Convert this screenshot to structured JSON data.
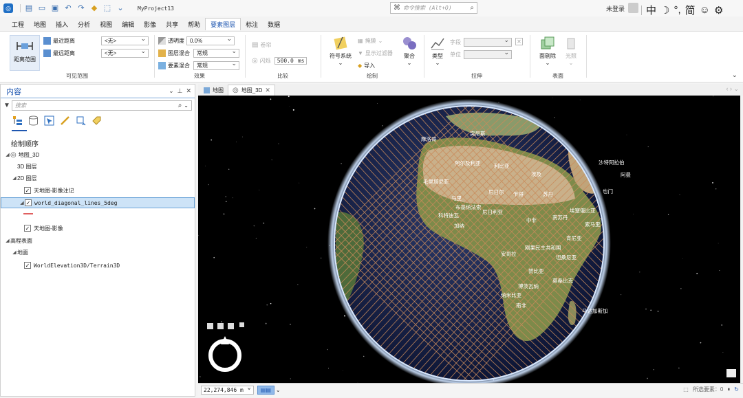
{
  "titlebar": {
    "project_name": "MyProject13",
    "search_placeholder": "命令搜索 (Alt+Q)",
    "login": "未登录",
    "tools": [
      "中",
      "☽",
      "°,",
      "简",
      "☺",
      "⚙"
    ]
  },
  "tabs": [
    "工程",
    "地图",
    "插入",
    "分析",
    "视图",
    "编辑",
    "影像",
    "共享",
    "帮助",
    "要素图层",
    "标注",
    "数据"
  ],
  "active_tab": "要素图层",
  "ribbon": {
    "visible_range": {
      "big_button": "距离范围",
      "min_label": "最近距离",
      "max_label": "最远距离",
      "min_value": "<无>",
      "max_value": "<无>",
      "group_label": "可见范围"
    },
    "effects": {
      "transparency_label": "透明度",
      "transparency_value": "0.0%",
      "layer_blend_label": "图层混合",
      "layer_blend_value": "常规",
      "feature_blend_label": "要素混合",
      "feature_blend_value": "常规",
      "group_label": "效果"
    },
    "compare": {
      "swipe_label": "卷帘",
      "flicker_label": "闪烁",
      "flicker_value": "500.0",
      "flicker_unit": "ms",
      "group_label": "比较"
    },
    "drawing": {
      "symbology_label": "符号系统",
      "mask_label": "掩膜",
      "show_filter_label": "显示过滤器",
      "import_label": "导入",
      "aggregate_label": "聚合",
      "group_label": "绘制"
    },
    "extrusion": {
      "type_label": "类型",
      "field_label": "字段",
      "unit_label": "单位",
      "group_label": "拉伸"
    },
    "faces": {
      "culling_label": "面剔除",
      "lighting_label": "光照",
      "group_label": "表面"
    }
  },
  "contents": {
    "title": "内容",
    "search_placeholder": "搜索",
    "section_title": "绘制顺序",
    "tree": [
      {
        "label": "地图_3D",
        "level": 0,
        "arrow": "◢",
        "check": false,
        "icon": true
      },
      {
        "label": "3D 图层",
        "level": 1,
        "arrow": "",
        "check": false
      },
      {
        "label": "2D 图层",
        "level": 1,
        "arrow": "◢",
        "check": false
      },
      {
        "label": "天地图-影像注记",
        "level": 2,
        "arrow": "",
        "check": true
      },
      {
        "label": "world_diagonal_lines_5deg",
        "level": 2,
        "arrow": "◢",
        "check": true,
        "selected": true,
        "mono": true
      },
      {
        "label": "天地图-影像",
        "level": 2,
        "arrow": "",
        "check": true
      },
      {
        "label": "高程表面",
        "level": 0,
        "arrow": "◢",
        "check": false
      },
      {
        "label": "地面",
        "level": 1,
        "arrow": "◢",
        "check": false
      },
      {
        "label": "WorldElevation3D/Terrain3D",
        "level": 2,
        "arrow": "",
        "check": true,
        "mono": true
      }
    ]
  },
  "map_tabs": [
    {
      "label": "地图",
      "active": false
    },
    {
      "label": "地图_3D",
      "active": true
    }
  ],
  "map_labels": [
    "阿尔及利亚",
    "利比亚",
    "埃及",
    "毛里塔尼亚",
    "马里",
    "尼日尔",
    "乍得",
    "苏丹",
    "埃塞俄比亚",
    "尼日利亚",
    "中非",
    "南苏丹",
    "刚果民主共和国",
    "安哥拉",
    "赞比亚",
    "博茨瓦纳",
    "纳米比亚",
    "南非",
    "肯尼亚",
    "索马里",
    "坦桑尼亚",
    "莫桑比克",
    "马达加斯加",
    "科特迪瓦",
    "加纳",
    "布基纳法索",
    "摩洛哥",
    "突尼斯",
    "沙特阿拉伯",
    "也门",
    "阿曼"
  ],
  "status": {
    "scale": "22,274,846 m",
    "selected_features": "所选要素：0"
  },
  "colors": {
    "accent": "#1e56b0",
    "grid_line": "#c98b5a",
    "selection": "#cde3f7"
  }
}
